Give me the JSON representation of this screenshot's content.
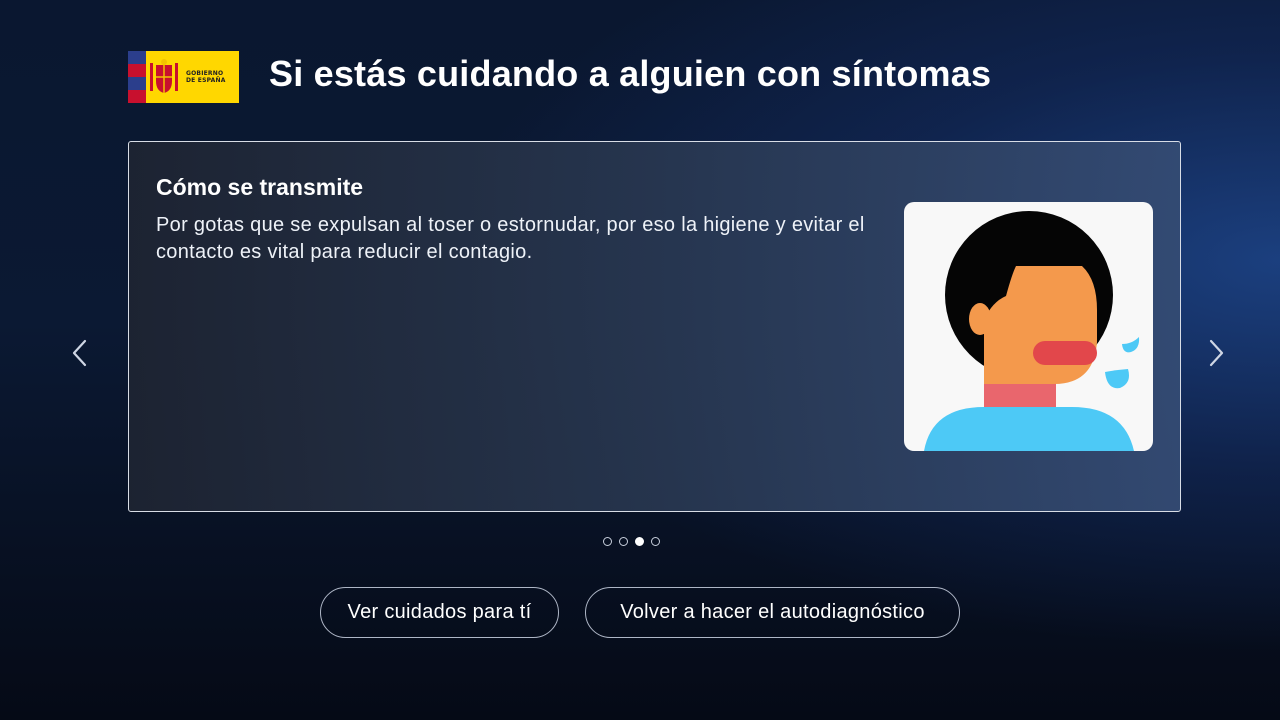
{
  "header": {
    "logo_text_line1": "GOBIERNO",
    "logo_text_line2": "DE ESPAÑA",
    "title": "Si estás cuidando a alguien con síntomas"
  },
  "card": {
    "title": "Cómo se transmite",
    "body": "Por gotas que se expulsan al toser o estornudar, por eso la higiene y evitar el contacto es vital para reducir el contagio.",
    "illustration": "person-coughing-icon"
  },
  "carousel": {
    "prev_icon": "chevron-left-icon",
    "next_icon": "chevron-right-icon",
    "total_slides": 4,
    "active_slide": 3
  },
  "actions": {
    "care_button": "Ver cuidados para tí",
    "redo_button": "Volver a hacer el autodiagnóstico"
  },
  "colors": {
    "logo_yellow": "#ffd700",
    "skin": "#f4994c",
    "shirt": "#4dc9f6",
    "mouth": "#e2474b"
  }
}
